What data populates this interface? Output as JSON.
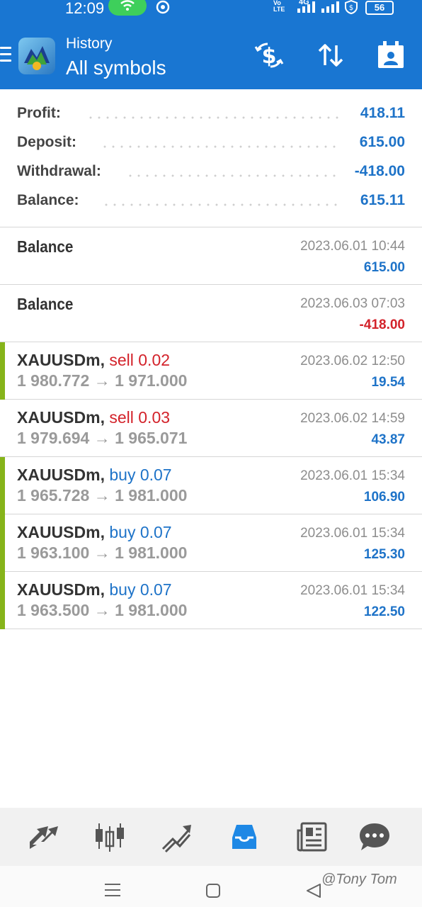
{
  "status_bar": {
    "time": "12:09",
    "volte": "Vo LTE",
    "network": "4G",
    "battery": "56"
  },
  "header": {
    "subtitle": "History",
    "title": "All symbols"
  },
  "summary": [
    {
      "label": "Profit:",
      "value": "418.11"
    },
    {
      "label": "Deposit:",
      "value": "615.00"
    },
    {
      "label": "Withdrawal:",
      "value": "-418.00"
    },
    {
      "label": "Balance:",
      "value": "615.11"
    }
  ],
  "deals": [
    {
      "title": "Balance",
      "date": "2023.06.01 10:44",
      "amount": "615.00",
      "amount_color": "blue"
    },
    {
      "title": "Balance",
      "date": "2023.06.03 07:03",
      "amount": "-418.00",
      "amount_color": "red"
    }
  ],
  "trades": [
    {
      "symbol": "XAUUSDm,",
      "direction": "sell 0.02",
      "side": "sell",
      "open": "1 980.772",
      "arrow": "→",
      "close": "1 971.000",
      "date": "2023.06.02 12:50",
      "profit": "19.54",
      "marker": true
    },
    {
      "symbol": "XAUUSDm,",
      "direction": "sell 0.03",
      "side": "sell",
      "open": "1 979.694",
      "arrow": "→",
      "close": "1 965.071",
      "date": "2023.06.02 14:59",
      "profit": "43.87",
      "marker": false
    },
    {
      "symbol": "XAUUSDm,",
      "direction": "buy 0.07",
      "side": "buy",
      "open": "1 965.728",
      "arrow": "→",
      "close": "1 981.000",
      "date": "2023.06.01 15:34",
      "profit": "106.90",
      "marker": true
    },
    {
      "symbol": "XAUUSDm,",
      "direction": "buy 0.07",
      "side": "buy",
      "open": "1 963.100",
      "arrow": "→",
      "close": "1 981.000",
      "date": "2023.06.01 15:34",
      "profit": "125.30",
      "marker": true
    },
    {
      "symbol": "XAUUSDm,",
      "direction": "buy 0.07",
      "side": "buy",
      "open": "1 963.500",
      "arrow": "→",
      "close": "1 981.000",
      "date": "2023.06.01 15:34",
      "profit": "122.50",
      "marker": true
    }
  ],
  "bottom_nav": [
    "quotes-icon",
    "chart-icon",
    "trade-icon",
    "history-icon",
    "news-icon",
    "chat-icon"
  ],
  "colors": {
    "accent": "#1976d2",
    "active_nav": "#1e88e5",
    "profit": "#1e73c8",
    "loss": "#d3222a",
    "marker": "#86b41a"
  },
  "watermark": "@Tony Tom"
}
